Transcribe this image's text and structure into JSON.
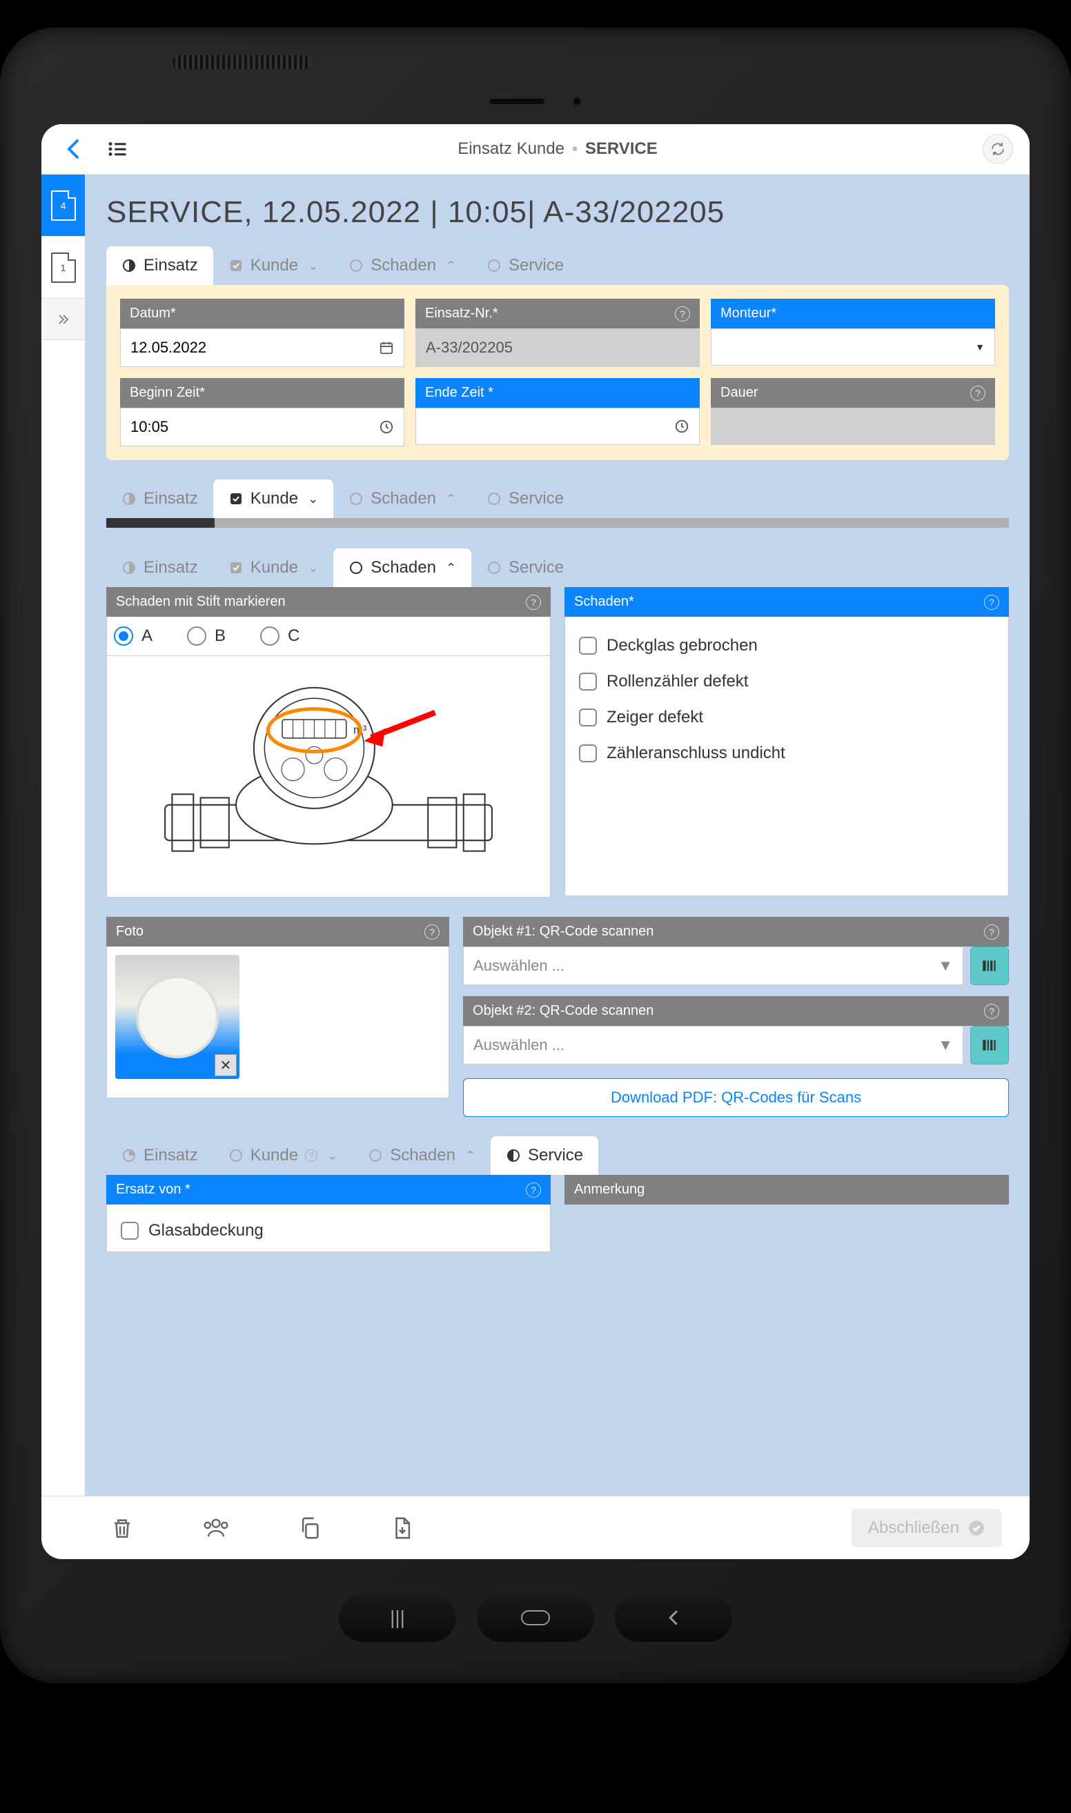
{
  "topbar": {
    "title_left": "Einsatz Kunde",
    "title_right": "SERVICE"
  },
  "sidebar": {
    "doc1_badge": "4",
    "doc2_badge": "1"
  },
  "page_title": "SERVICE,  12.05.2022 | 10:05| A-33/202205",
  "tabs": {
    "einsatz": "Einsatz",
    "kunde": "Kunde",
    "schaden": "Schaden",
    "service": "Service"
  },
  "einsatz": {
    "datum_label": "Datum*",
    "datum_value": "12.05.2022",
    "einsatznr_label": "Einsatz-Nr.*",
    "einsatznr_value": "A-33/202205",
    "monteur_label": "Monteur*",
    "beginn_label": "Beginn Zeit*",
    "beginn_value": "10:05",
    "ende_label": "Ende Zeit *",
    "dauer_label": "Dauer"
  },
  "schaden": {
    "mark_label": "Schaden mit Stift markieren",
    "schaden_label": "Schaden*",
    "radio_a": "A",
    "radio_b": "B",
    "radio_c": "C",
    "opt1": "Deckglas gebrochen",
    "opt2": "Rollenzähler defekt",
    "opt3": "Zeiger defekt",
    "opt4": "Zähleranschluss undicht"
  },
  "foto": {
    "foto_label": "Foto",
    "obj1_label": "Objekt #1: QR-Code scannen",
    "obj2_label": "Objekt #2: QR-Code scannen",
    "select_placeholder": "Auswählen ...",
    "pdf_link": "Download PDF: QR-Codes für Scans"
  },
  "service": {
    "ersatz_label": "Ersatz von *",
    "anmerkung_label": "Anmerkung",
    "ersatz_opt1": "Glasabdeckung"
  },
  "bottom": {
    "finish": "Abschließen"
  }
}
